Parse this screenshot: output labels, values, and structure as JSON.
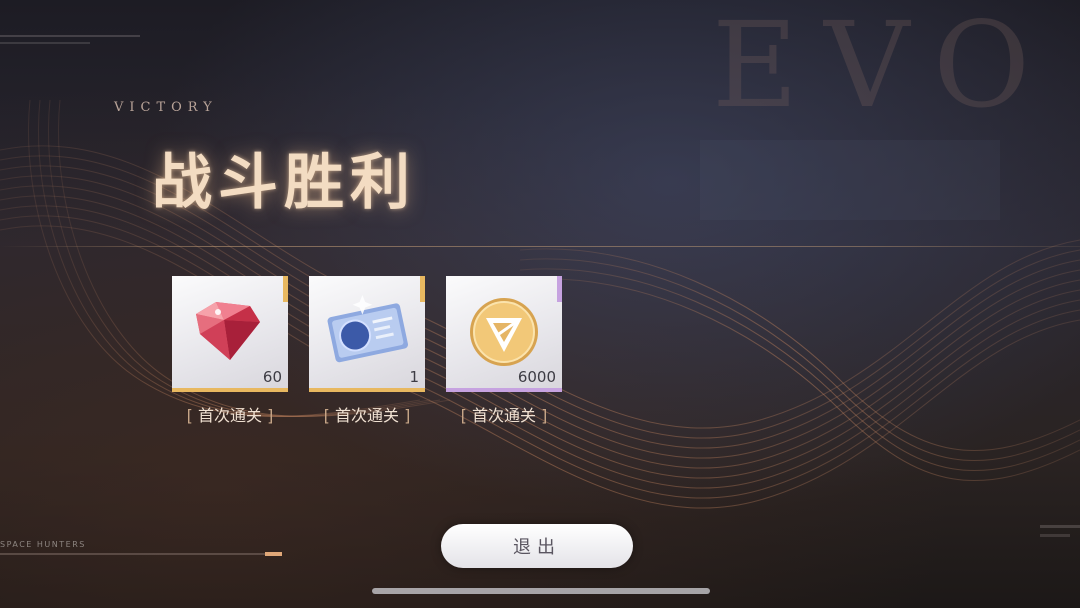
{
  "header": {
    "watermark": "EVO",
    "subtitle": "VICTORY",
    "title": "战斗胜利"
  },
  "rewards": [
    {
      "icon": "red-gem-icon",
      "quantity": "60",
      "tag_open": "[",
      "tag": "首次通关",
      "tag_close": "]",
      "rarity_color": "#e8b860"
    },
    {
      "icon": "blue-ticket-icon",
      "quantity": "1",
      "tag_open": "[",
      "tag": "首次通关",
      "tag_close": "]",
      "rarity_color": "#e8b860"
    },
    {
      "icon": "gold-coin-icon",
      "quantity": "6000",
      "tag_open": "[",
      "tag": "首次通关",
      "tag_close": "]",
      "rarity_color": "#c6a2e0"
    }
  ],
  "exit_button": {
    "label": "退出"
  },
  "footer": {
    "label": "SPACE HUNTERS",
    "progress": 0.94
  },
  "colors": {
    "accent_gold": "#e8b860",
    "accent_purple": "#c6a2e0",
    "title_glow": "#f3dcc2"
  }
}
